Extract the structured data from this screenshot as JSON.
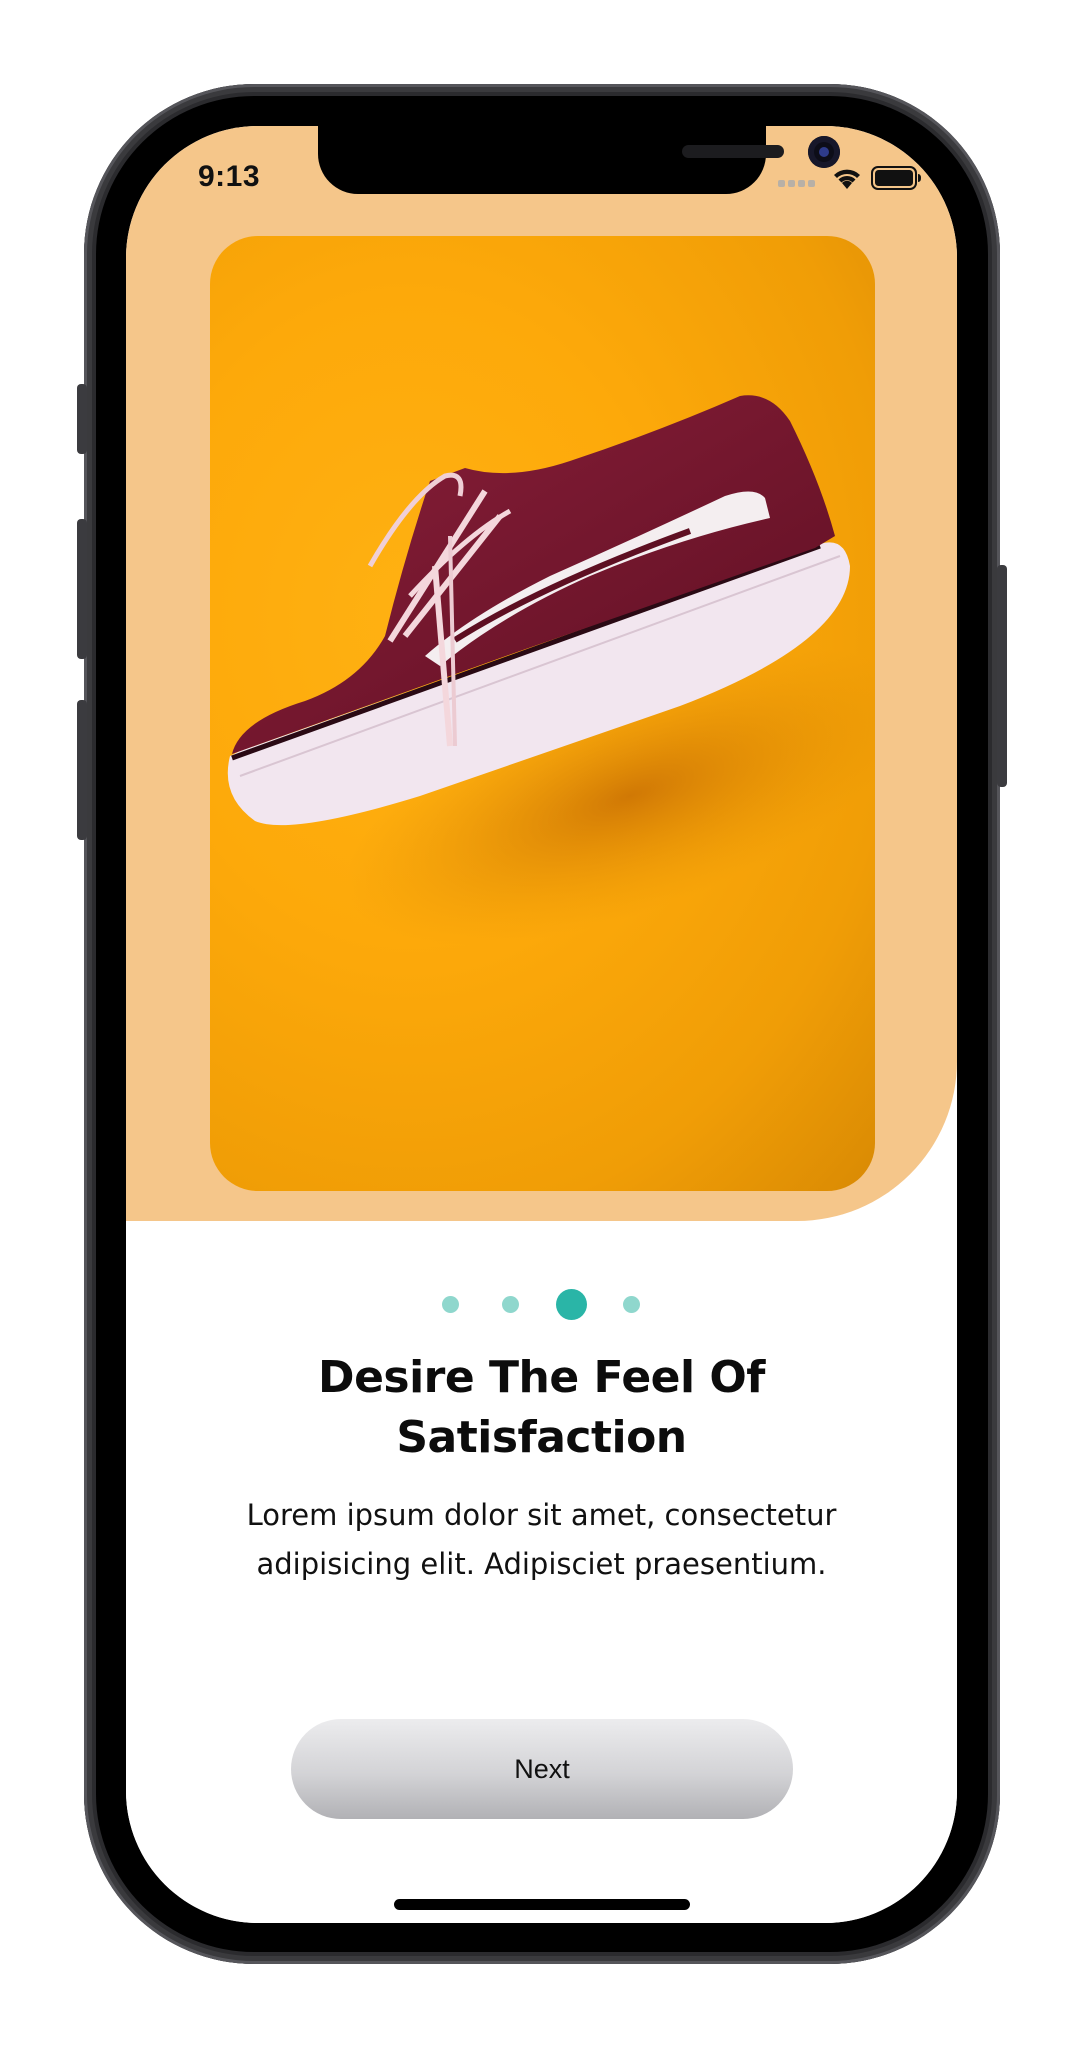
{
  "status_bar": {
    "time": "9:13"
  },
  "onboarding": {
    "image_subject": "maroon-sneaker",
    "pagination": {
      "total": 4,
      "active_index": 2
    },
    "title": "Desire The Feel Of Satisfaction",
    "description": "Lorem ipsum dolor sit amet, consectetur adipisicing elit. Adipisciet praesentium.",
    "next_label": "Next"
  },
  "colors": {
    "background_top": "#f5c68a",
    "photo_background": "#fda90a",
    "dot_active": "#2ab5a7",
    "dot_inactive": "#8fd7cd"
  }
}
